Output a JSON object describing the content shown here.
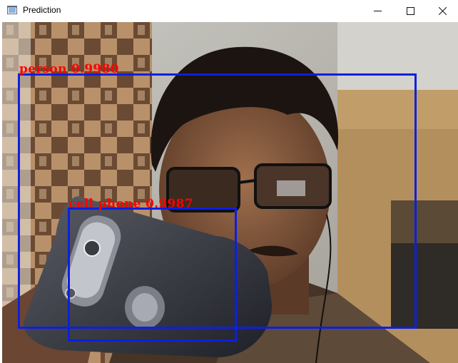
{
  "window": {
    "title": "Prediction",
    "icon": "window-app-icon",
    "controls": {
      "minimize_icon": "minimize-icon",
      "maximize_icon": "maximize-icon",
      "close_icon": "close-icon"
    }
  },
  "detections": [
    {
      "class_name": "person",
      "score": "0.9980",
      "label": "person 0.9980"
    },
    {
      "class_name": "cell phone",
      "score": "0.9987",
      "label": "cell phone 0.9987"
    }
  ],
  "colors": {
    "box": "#0d1fe0",
    "label": "#ff0000"
  }
}
